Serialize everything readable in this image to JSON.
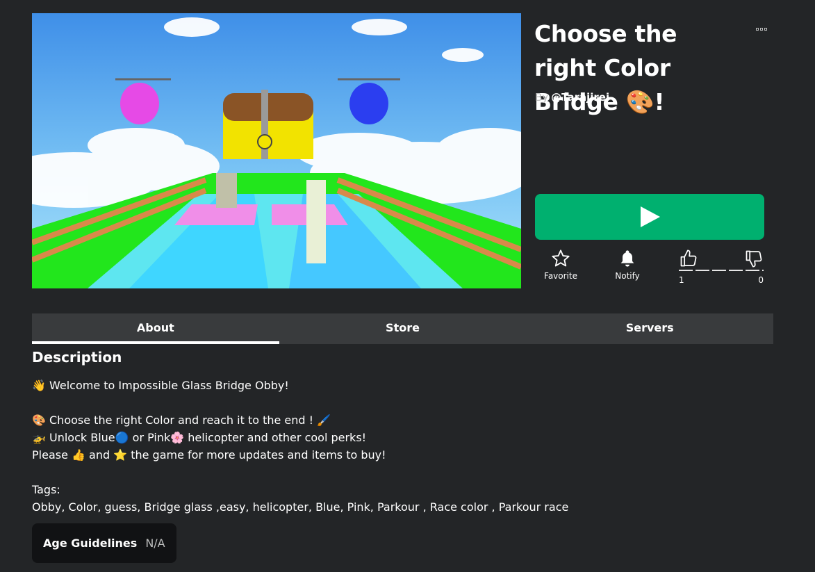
{
  "game": {
    "title": "Choose the right Color Bridge 🎨!",
    "by_label": "By",
    "creator": "@Tarajirei"
  },
  "actions": {
    "favorite_label": "Favorite",
    "notify_label": "Notify",
    "upvotes": "1",
    "downvotes": "0"
  },
  "tabs": [
    {
      "label": "About",
      "active": true
    },
    {
      "label": "Store",
      "active": false
    },
    {
      "label": "Servers",
      "active": false
    }
  ],
  "description": {
    "heading": "Description",
    "lines": [
      "👋 Welcome to Impossible Glass Bridge Obby!",
      "",
      "🎨 Choose the right Color and reach it to the end ! 🖌️",
      "🚁 Unlock Blue🔵 or Pink🌸 helicopter and other cool perks!",
      "Please 👍 and ⭐ the game for more updates and items to buy!",
      "",
      "Tags:",
      "Obby, Color, guess, Bridge glass ,easy, helicopter, Blue, Pink, Parkour , Race color , Parkour race"
    ]
  },
  "age": {
    "label": "Age Guidelines",
    "value": "N/A"
  },
  "colors": {
    "background": "#232527",
    "play_button": "#00b06f",
    "tab_bar": "#393b3d",
    "age_box": "#111214"
  },
  "icons": {
    "play": "play-icon",
    "favorite": "star-icon",
    "notify": "bell-icon",
    "upvote": "thumbs-up-icon",
    "downvote": "thumbs-down-icon",
    "more": "more-options-icon"
  }
}
